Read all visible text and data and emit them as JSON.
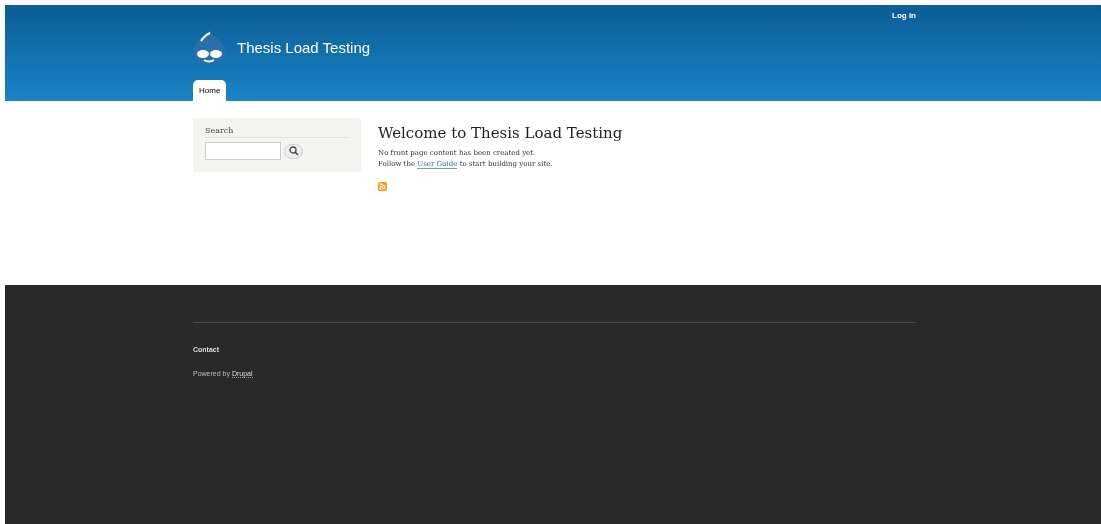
{
  "header": {
    "user_link": "Log in",
    "site_name": "Thesis Load Testing",
    "tabs": [
      {
        "label": "Home",
        "selected": true
      }
    ]
  },
  "sidebar": {
    "block_title": "Search"
  },
  "main": {
    "title": "Welcome to Thesis Load Testing",
    "lines": [
      {
        "text": "No front page content has been created yet."
      },
      {
        "before": "Follow the ",
        "link": "User Guide",
        "after": " to start building your site."
      }
    ]
  },
  "footer": {
    "menu": [
      "Contact"
    ],
    "powered_prefix": "Powered by ",
    "powered_link": "Drupal"
  }
}
